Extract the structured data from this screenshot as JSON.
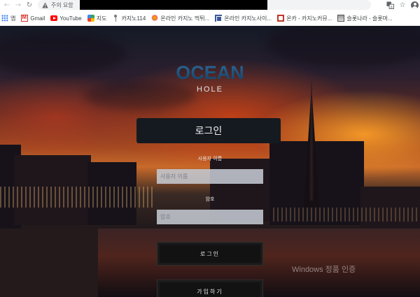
{
  "browser": {
    "security_label": "주의 요함",
    "bookmarks": [
      {
        "label": "앱",
        "icon": "apps-icon"
      },
      {
        "label": "Gmail",
        "icon": "gmail-icon"
      },
      {
        "label": "YouTube",
        "icon": "youtube-icon"
      },
      {
        "label": "지도",
        "icon": "maps-icon"
      },
      {
        "label": "카지노114",
        "icon": "pin-icon"
      },
      {
        "label": "온라인 카지노 먹튀...",
        "icon": "casino-icon"
      },
      {
        "label": "온라인 카지노사이...",
        "icon": "casino-site-icon"
      },
      {
        "label": "온카 - 카지노커뮤...",
        "icon": "onca-icon"
      },
      {
        "label": "슬롯나라 - 슬롯머...",
        "icon": "slot-icon"
      }
    ]
  },
  "login": {
    "logo_main": "OCEAN",
    "logo_sub": "HOLE",
    "title": "로그인",
    "username_label": "사용자 이름",
    "username_placeholder": "사용자 이름",
    "password_label": "암호",
    "password_placeholder": "암호",
    "login_button": "로그인",
    "signup_button": "가입하기"
  },
  "overlay": {
    "watermark": "Windows 정품 인증"
  }
}
